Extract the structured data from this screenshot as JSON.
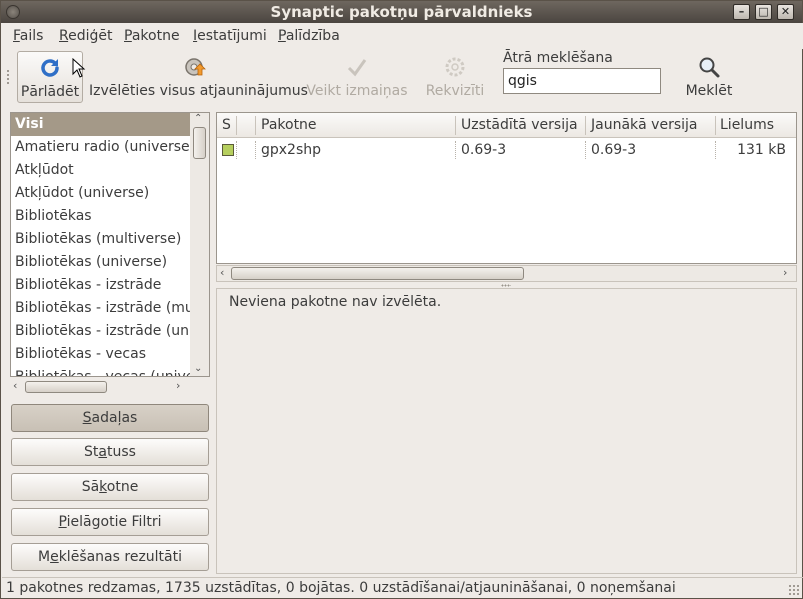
{
  "window": {
    "title": "Synaptic pakotņu pārvaldnieks"
  },
  "menu": [
    {
      "pre": "",
      "u": "F",
      "post": "ails"
    },
    {
      "pre": "",
      "u": "R",
      "post": "ediģēt"
    },
    {
      "pre": "",
      "u": "P",
      "post": "akotne"
    },
    {
      "pre": "",
      "u": "I",
      "post": "estatījumi"
    },
    {
      "pre": "",
      "u": "P",
      "post": "alīdzība"
    }
  ],
  "toolbar": {
    "reload": "Pārlādēt",
    "mark_all": "Izvēlēties visus atjauninājumus",
    "apply": "Veikt izmaiņas",
    "properties": "Rekvizīti",
    "search": "Meklēt",
    "quick_search_label": "Ātrā meklēšana",
    "quick_search_value": "qgis"
  },
  "categories": [
    "Visi",
    "Amatieru radio (universe)",
    "Atkļūdot",
    "Atkļūdot (universe)",
    "Bibliotēkas",
    "Bibliotēkas (multiverse)",
    "Bibliotēkas (universe)",
    "Bibliotēkas - izstrāde",
    "Bibliotēkas - izstrāde (multiverse)",
    "Bibliotēkas - izstrāde (universe)",
    "Bibliotēkas - vecas",
    "Bibliotēkas - vecas (universe)"
  ],
  "filters": {
    "sections": {
      "pre": "",
      "u": "S",
      "post": "adaļas"
    },
    "status": {
      "pre": "St",
      "u": "a",
      "post": "tuss"
    },
    "origin": {
      "pre": "Sā",
      "u": "k",
      "post": "otne"
    },
    "custom": {
      "pre": "",
      "u": "P",
      "post": "ielāgotie Filtri"
    },
    "search_results": {
      "pre": "M",
      "u": "e",
      "post": "klēšanas rezultāti"
    }
  },
  "table": {
    "columns": {
      "s": "S",
      "package": "Pakotne",
      "installed": "Uzstādītā versija",
      "latest": "Jaunākā versija",
      "size": "Lielums"
    },
    "rows": [
      {
        "package": "gpx2shp",
        "installed": "0.69-3",
        "latest": "0.69-3",
        "size": "131 kB",
        "status_color": "#b6cf5e"
      }
    ]
  },
  "description": "Neviena pakotne nav izvēlēta.",
  "statusbar": "1 pakotnes redzamas, 1735 uzstādītas, 0 bojātas. 0 uzstādīšanai/atjaunināšanai, 0 noņemšanai"
}
